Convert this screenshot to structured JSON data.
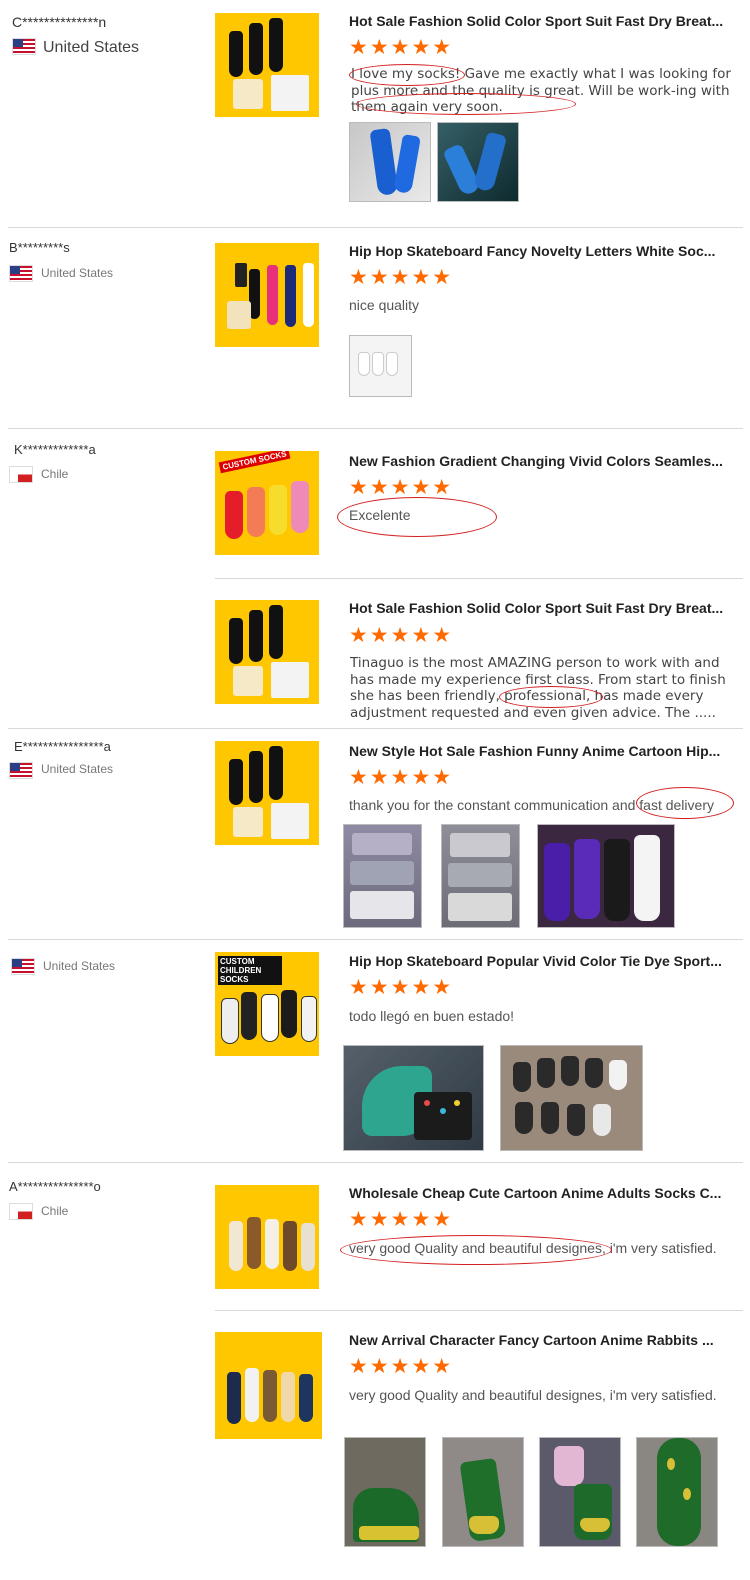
{
  "reviews": [
    {
      "buyer": "C**************n",
      "country": "United States",
      "title": "Hot Sale Fashion Solid Color Sport Suit Fast Dry Breat...",
      "stars": "★★★★★",
      "text": "I love my socks! Gave me exactly what I was looking for plus more and the quality is great. Will be work-ing with them again very soon."
    },
    {
      "buyer": "B*********s",
      "country": "United States",
      "title": "Hip Hop Skateboard Fancy Novelty Letters White Soc...",
      "stars": "★★★★★",
      "text": "nice quality"
    },
    {
      "buyer": "K*************a",
      "country": "Chile",
      "title": "New Fashion Gradient Changing Vivid Colors Seamles...",
      "stars": "★★★★★",
      "text": "Excelente",
      "product_label": "CUSTOM SOCKS"
    },
    {
      "title": "Hot Sale Fashion Solid Color Sport Suit Fast Dry Breat...",
      "stars": "★★★★★",
      "text": "Tinaguo is the most AMAZING person to work with and has made my experience first class. From start to finish she has been friendly, professional, has made every adjustment requested and even given advice. The ....."
    },
    {
      "buyer": "E****************a",
      "country": "United States",
      "title": "New Style Hot Sale Fashion Funny Anime Cartoon Hip...",
      "stars": "★★★★★",
      "text": "thank you for the constant communication and fast delivery"
    },
    {
      "country": "United States",
      "title": "Hip Hop Skateboard Popular Vivid Color Tie Dye Sport...",
      "stars": "★★★★★",
      "text": "todo llegó en buen estado!",
      "product_label": "CUSTOM CHILDREN SOCKS"
    },
    {
      "buyer": "A***************o",
      "country": "Chile",
      "title": "Wholesale Cheap Cute Cartoon Anime Adults Socks C...",
      "stars": "★★★★★",
      "text": "very good Quality and beautiful designes, i'm very satisfied."
    },
    {
      "title": "New Arrival Character Fancy Cartoon Anime Rabbits ...",
      "stars": "★★★★★",
      "text": "very good Quality and beautiful designes, i'm very satisfied."
    }
  ],
  "colors": {
    "star": "#ff6a00",
    "highlight": "#d32020",
    "product_bg": "#ffc700"
  }
}
